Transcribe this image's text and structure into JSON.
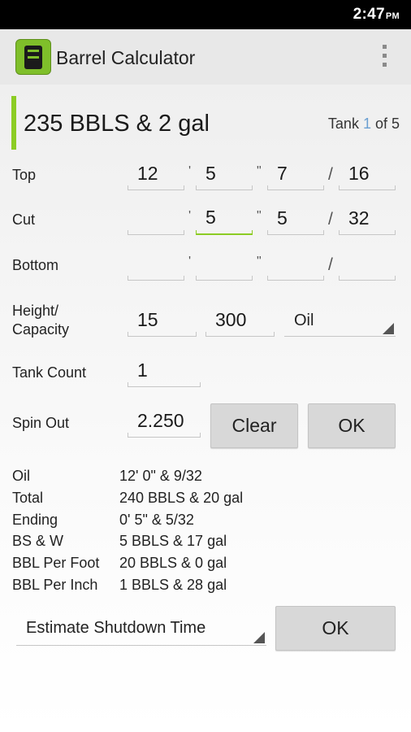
{
  "status_bar": {
    "time": "2:47",
    "ampm": "PM"
  },
  "app": {
    "title": "Barrel Calculator"
  },
  "tank": {
    "total": "235 BBLS & 2 gal",
    "counter_prefix": "Tank ",
    "counter_index": "1",
    "counter_suffix": " of 5"
  },
  "rows": {
    "top": {
      "label": "Top",
      "feet": "12",
      "inches": "5",
      "fraction": "7",
      "denominator": "16"
    },
    "cut": {
      "label": "Cut",
      "feet": "",
      "inches": "5",
      "fraction": "5",
      "denominator": "32"
    },
    "bottom": {
      "label": "Bottom",
      "feet": "",
      "inches": "",
      "fraction": "",
      "denominator": ""
    },
    "height_capacity": {
      "label_line1": "Height/",
      "label_line2": "Capacity",
      "height": "15",
      "capacity": "300",
      "fluid": "Oil"
    },
    "tank_count": {
      "label": "Tank Count",
      "value": "1"
    },
    "spin_out": {
      "label": "Spin Out",
      "value": "2.250"
    }
  },
  "separators": {
    "feet": "'",
    "inches": "\"",
    "slash": "/"
  },
  "buttons": {
    "clear": "Clear",
    "ok": "OK",
    "ok2": "OK"
  },
  "results": [
    {
      "label": "Oil",
      "value": "12' 0\" & 9/32"
    },
    {
      "label": "Total",
      "value": "240 BBLS & 20 gal"
    },
    {
      "label": "Ending",
      "value": "0' 5\" & 5/32"
    },
    {
      "label": "BS & W",
      "value": "5 BBLS & 17 gal"
    },
    {
      "label": "BBL Per Foot",
      "value": "20 BBLS & 0 gal"
    },
    {
      "label": "BBL Per Inch",
      "value": "1 BBLS & 28 gal"
    }
  ],
  "estimate": {
    "selected": "Estimate Shutdown Time"
  },
  "colors": {
    "accent": "#8ccc24",
    "status_bar": "#000000",
    "action_bar": "#e8e8e8",
    "counter_highlight": "#6a9fd1"
  }
}
